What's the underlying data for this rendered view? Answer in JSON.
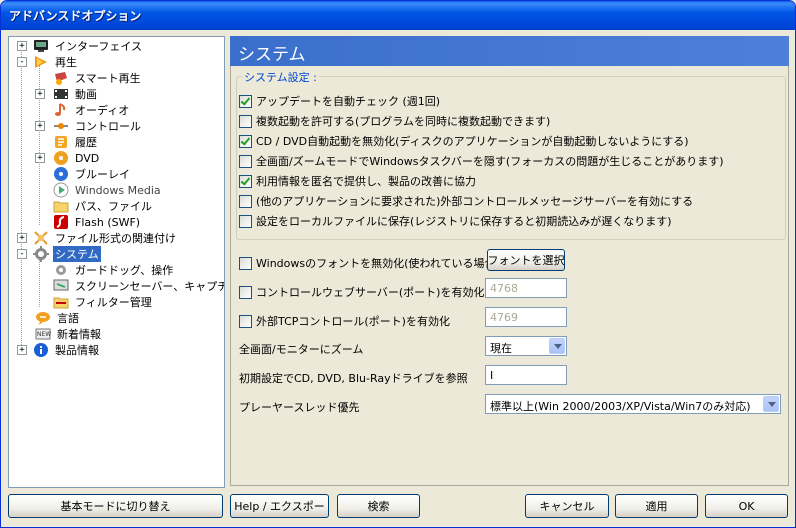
{
  "window": {
    "title": "アドバンスドオプション"
  },
  "tree": {
    "items": [
      {
        "label": "インターフェイス",
        "icon": "monitor-icon"
      },
      {
        "label": "再生",
        "icon": "play-icon"
      },
      {
        "label": "スマート再生",
        "icon": "smart-play-icon"
      },
      {
        "label": "動画",
        "icon": "film-icon"
      },
      {
        "label": "オーディオ",
        "icon": "music-note-icon"
      },
      {
        "label": "コントロール",
        "icon": "control-icon"
      },
      {
        "label": "履歴",
        "icon": "history-icon"
      },
      {
        "label": "DVD",
        "icon": "dvd-icon"
      },
      {
        "label": "ブルーレイ",
        "icon": "bluray-icon"
      },
      {
        "label": "Windows Media",
        "icon": "windows-media-icon"
      },
      {
        "label": "パス、ファイル",
        "icon": "folder-icon"
      },
      {
        "label": "Flash (SWF)",
        "icon": "flash-icon"
      },
      {
        "label": "ファイル形式の関連付け",
        "icon": "file-association-icon"
      },
      {
        "label": "システム",
        "icon": "gear-icon"
      },
      {
        "label": "ガードドッグ、操作",
        "icon": "gear-small-icon"
      },
      {
        "label": "スクリーンセーバー、キャプチャ",
        "icon": "screensaver-icon"
      },
      {
        "label": "フィルター管理",
        "icon": "filter-folder-icon"
      },
      {
        "label": "言語",
        "icon": "language-icon"
      },
      {
        "label": "新着情報",
        "icon": "news-icon"
      },
      {
        "label": "製品情報",
        "icon": "info-icon"
      }
    ]
  },
  "panel": {
    "title": "システム",
    "group_label": "システム設定 :",
    "checkboxes": [
      {
        "label": "アップデートを自動チェック (週1回)",
        "checked": true
      },
      {
        "label": "複数起動を許可する(プログラムを同時に複数起動できます)",
        "checked": false
      },
      {
        "label": "CD / DVD自動起動を無効化(ディスクのアプリケーションが自動起動しないようにする)",
        "checked": true
      },
      {
        "label": "全画面/ズームモードでWindowsタスクバーを隠す(フォーカスの問題が生じることがあります)",
        "checked": false
      },
      {
        "label": "利用情報を匿名で提供し、製品の改善に協力",
        "checked": true
      },
      {
        "label": "(他のアプリケーションに要求された)外部コントロールメッセージサーバーを有効にする",
        "checked": false
      },
      {
        "label": "設定をローカルファイルに保存(レジストリに保存すると初期読込みが遅くなります)",
        "checked": false
      }
    ],
    "font_disable": {
      "label": "Windowsのフォントを無効化(使われている場合の",
      "checked": false,
      "button": "フォントを選択"
    },
    "web_server": {
      "label": "コントロールウェブサーバー(ポート)を有効化",
      "checked": false,
      "port": "4768"
    },
    "tcp_control": {
      "label": "外部TCPコントロール(ポート)を有効化",
      "checked": false,
      "port": "4769"
    },
    "zoom": {
      "label": "全画面/モニターにズーム",
      "value": "現在"
    },
    "drive": {
      "label": "初期設定でCD, DVD, Blu-Rayドライブを参照",
      "value": "I"
    },
    "thread": {
      "label": "プレーヤースレッド優先",
      "value": "標準以上(Win 2000/2003/XP/Vista/Win7のみ対応)"
    }
  },
  "buttons": {
    "basic_mode": "基本モードに切り替え",
    "help": "Help / エクスポー",
    "search": "検索",
    "cancel": "キャンセル",
    "apply": "適用",
    "ok": "OK"
  }
}
